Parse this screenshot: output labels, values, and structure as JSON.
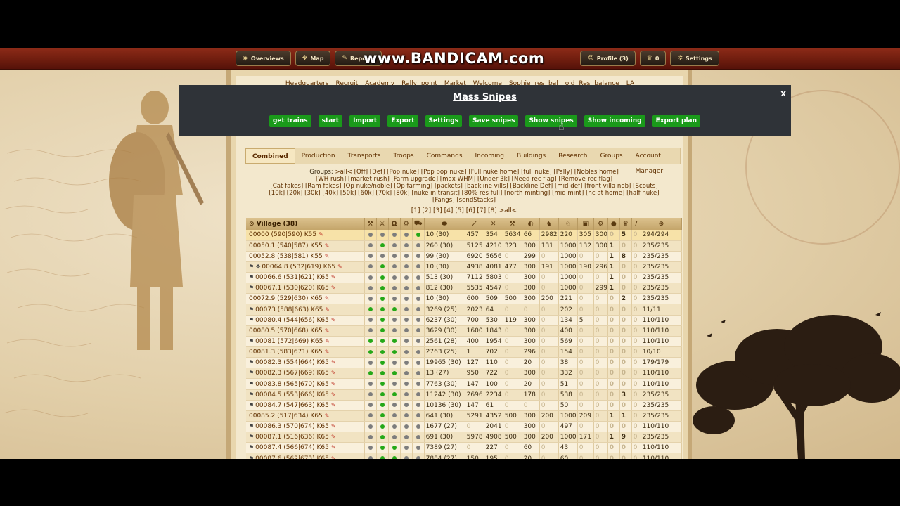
{
  "watermark": "www.BANDICAM.com",
  "topbar": {
    "buttons": [
      {
        "label": "Overviews",
        "icon": "globe-icon"
      },
      {
        "label": "Map",
        "icon": "map-icon"
      },
      {
        "label": "Reports",
        "icon": "report-icon"
      },
      {
        "label": "Profile (3)",
        "icon": "profile-icon"
      },
      {
        "label": "0",
        "icon": "premium-icon"
      },
      {
        "label": "Settings",
        "icon": "gear-icon"
      }
    ]
  },
  "village_links": [
    "Headquarters",
    "Recruit",
    "Academy",
    "Rally point",
    "Market",
    "Welcome",
    "Sophie res bal",
    "old Res balance",
    "LA"
  ],
  "modal": {
    "title": "Mass Snipes",
    "close": "x",
    "buttons": [
      "get trains",
      "start",
      "Import",
      "Export",
      "Settings",
      "Save snipes",
      "Show snipes",
      "Show incoming",
      "Export plan"
    ]
  },
  "tabs": [
    "Combined",
    "Production",
    "Transports",
    "Troops",
    "Commands",
    "Incoming",
    "Buildings",
    "Research",
    "Groups",
    "Account Manager"
  ],
  "groups": {
    "label": "Groups:",
    "lines": [
      ">all< [Off] [Def] [Pop nuke] [Pop pop nuke] [Full nuke home] [full nuke] [Pally] [Nobles home]",
      "[WH rush] [market rush] [Farm upgrade] [max WHM] [Under 3k] [Need rec flag] [Remove rec flag]",
      "[Cat fakes] [Ram fakes] [Op nuke/noble] [Op farming] [packets] [backline vills] [Backline Def] [mid def] [front villa nob] [Scouts]",
      "[10k] [20k] [30k] [40k] [50k] [60k] [70k] [80k] [nuke in transit] [80% res full] [north minting] [mid mint] [hc at home] [half nuke]",
      "[Fangs] [sendStacks]"
    ]
  },
  "pages": "[1] [2] [3] [4] [5] [6] [7] [8] >all<",
  "table": {
    "village_header": "Village (38)",
    "rows": [
      {
        "name": "00000 (590|590) K55",
        "flag": "",
        "dots": [
          "x",
          "x",
          "x",
          "x",
          "g"
        ],
        "farm": "10 (30)",
        "u": [
          "457",
          "354",
          "5634",
          "66",
          "2982",
          "220",
          "305",
          "300",
          "0",
          "5",
          "0"
        ],
        "pop": "294/294",
        "hl": true
      },
      {
        "name": "00050.1 (540|587) K55",
        "flag": "",
        "dots": [
          "x",
          "g",
          "x",
          "x",
          "x"
        ],
        "farm": "260 (30)",
        "u": [
          "5125",
          "4210",
          "323",
          "300",
          "131",
          "1000",
          "132",
          "300",
          "1",
          "0",
          "0"
        ],
        "pop": "235/235"
      },
      {
        "name": "00052.8 (538|581) K55",
        "flag": "",
        "dots": [
          "x",
          "x",
          "x",
          "x",
          "x"
        ],
        "farm": "99 (30)",
        "u": [
          "6920",
          "5656",
          "0",
          "299",
          "0",
          "1000",
          "0",
          "0",
          "1",
          "8",
          "0"
        ],
        "pop": "235/235"
      },
      {
        "name": "00064.8 (532|619) K65",
        "flag": "both",
        "dots": [
          "x",
          "g",
          "x",
          "x",
          "x"
        ],
        "farm": "10 (30)",
        "u": [
          "4938",
          "4081",
          "477",
          "300",
          "191",
          "1000",
          "190",
          "296",
          "1",
          "0",
          "0"
        ],
        "pop": "235/235"
      },
      {
        "name": "00066.6 (531|621) K65",
        "flag": "flag",
        "dots": [
          "x",
          "g",
          "x",
          "x",
          "x"
        ],
        "farm": "513 (30)",
        "u": [
          "7112",
          "5803",
          "0",
          "300",
          "0",
          "1000",
          "0",
          "0",
          "1",
          "0",
          "0"
        ],
        "pop": "235/235"
      },
      {
        "name": "00067.1 (530|620) K65",
        "flag": "flag",
        "dots": [
          "x",
          "g",
          "x",
          "x",
          "x"
        ],
        "farm": "812 (30)",
        "u": [
          "5535",
          "4547",
          "0",
          "300",
          "0",
          "1000",
          "0",
          "299",
          "1",
          "0",
          "0"
        ],
        "pop": "235/235"
      },
      {
        "name": "00072.9 (529|630) K65",
        "flag": "",
        "dots": [
          "x",
          "g",
          "x",
          "x",
          "x"
        ],
        "farm": "10 (30)",
        "u": [
          "600",
          "509",
          "500",
          "300",
          "200",
          "221",
          "0",
          "0",
          "0",
          "2",
          "0"
        ],
        "pop": "235/235"
      },
      {
        "name": "00073 (588|663) K65",
        "flag": "flag",
        "dots": [
          "g",
          "g",
          "g",
          "x",
          "x"
        ],
        "farm": "3269 (25)",
        "u": [
          "2023",
          "64",
          "0",
          "0",
          "0",
          "202",
          "0",
          "0",
          "0",
          "0",
          "0"
        ],
        "pop": "11/11"
      },
      {
        "name": "00080.4 (544|656) K65",
        "flag": "flag",
        "dots": [
          "x",
          "g",
          "x",
          "x",
          "x"
        ],
        "farm": "6237 (30)",
        "u": [
          "700",
          "530",
          "119",
          "300",
          "0",
          "134",
          "5",
          "0",
          "0",
          "0",
          "0"
        ],
        "pop": "110/110"
      },
      {
        "name": "00080.5 (570|668) K65",
        "flag": "",
        "dots": [
          "x",
          "g",
          "x",
          "x",
          "x"
        ],
        "farm": "3629 (30)",
        "u": [
          "1600",
          "1843",
          "0",
          "300",
          "0",
          "400",
          "0",
          "0",
          "0",
          "0",
          "0"
        ],
        "pop": "110/110"
      },
      {
        "name": "00081 (572|669) K65",
        "flag": "flag",
        "dots": [
          "g",
          "g",
          "g",
          "x",
          "x"
        ],
        "farm": "2561 (28)",
        "u": [
          "400",
          "1954",
          "0",
          "300",
          "0",
          "569",
          "0",
          "0",
          "0",
          "0",
          "0"
        ],
        "pop": "110/110"
      },
      {
        "name": "00081.3 (583|671) K65",
        "flag": "",
        "dots": [
          "g",
          "g",
          "g",
          "x",
          "x"
        ],
        "farm": "2763 (25)",
        "u": [
          "1",
          "702",
          "0",
          "296",
          "0",
          "154",
          "0",
          "0",
          "0",
          "0",
          "0"
        ],
        "pop": "10/10"
      },
      {
        "name": "00082.3 (554|664) K65",
        "flag": "flag",
        "dots": [
          "x",
          "g",
          "x",
          "x",
          "x"
        ],
        "farm": "19965 (30)",
        "u": [
          "127",
          "110",
          "0",
          "20",
          "0",
          "38",
          "0",
          "0",
          "0",
          "0",
          "0"
        ],
        "pop": "179/179"
      },
      {
        "name": "00082.3 (567|669) K65",
        "flag": "flag",
        "dots": [
          "g",
          "g",
          "g",
          "x",
          "x"
        ],
        "farm": "13 (27)",
        "u": [
          "950",
          "722",
          "0",
          "300",
          "0",
          "332",
          "0",
          "0",
          "0",
          "0",
          "0"
        ],
        "pop": "110/110"
      },
      {
        "name": "00083.8 (565|670) K65",
        "flag": "flag",
        "dots": [
          "x",
          "g",
          "x",
          "x",
          "x"
        ],
        "farm": "7763 (30)",
        "u": [
          "147",
          "100",
          "0",
          "20",
          "0",
          "51",
          "0",
          "0",
          "0",
          "0",
          "0"
        ],
        "pop": "110/110"
      },
      {
        "name": "00084.5 (553|666) K65",
        "flag": "flag",
        "dots": [
          "x",
          "g",
          "g",
          "x",
          "x"
        ],
        "farm": "11242 (30)",
        "u": [
          "2696",
          "2234",
          "0",
          "178",
          "0",
          "538",
          "0",
          "0",
          "0",
          "3",
          "0"
        ],
        "pop": "235/235"
      },
      {
        "name": "00084.7 (547|663) K65",
        "flag": "flag",
        "dots": [
          "x",
          "g",
          "x",
          "x",
          "x"
        ],
        "farm": "10136 (30)",
        "u": [
          "147",
          "61",
          "0",
          "0",
          "0",
          "50",
          "0",
          "0",
          "0",
          "0",
          "0"
        ],
        "pop": "235/235"
      },
      {
        "name": "00085.2 (517|634) K65",
        "flag": "",
        "dots": [
          "x",
          "g",
          "x",
          "x",
          "x"
        ],
        "farm": "641 (30)",
        "u": [
          "5291",
          "4352",
          "500",
          "300",
          "200",
          "1000",
          "209",
          "0",
          "1",
          "1",
          "0"
        ],
        "pop": "235/235"
      },
      {
        "name": "00086.3 (570|674) K65",
        "flag": "flag",
        "dots": [
          "x",
          "g",
          "x",
          "x",
          "x"
        ],
        "farm": "1677 (27)",
        "u": [
          "0",
          "2041",
          "0",
          "300",
          "0",
          "497",
          "0",
          "0",
          "0",
          "0",
          "0"
        ],
        "pop": "110/110"
      },
      {
        "name": "00087.1 (516|636) K65",
        "flag": "flag",
        "dots": [
          "x",
          "g",
          "x",
          "x",
          "x"
        ],
        "farm": "691 (30)",
        "u": [
          "5978",
          "4908",
          "500",
          "300",
          "200",
          "1000",
          "171",
          "0",
          "1",
          "9",
          "0"
        ],
        "pop": "235/235"
      },
      {
        "name": "00087.4 (566|674) K65",
        "flag": "flag",
        "dots": [
          "x",
          "g",
          "g",
          "x",
          "x"
        ],
        "farm": "7389 (27)",
        "u": [
          "0",
          "227",
          "0",
          "60",
          "0",
          "43",
          "0",
          "0",
          "0",
          "0",
          "0"
        ],
        "pop": "110/110"
      },
      {
        "name": "00087.6 (562|673) K65",
        "flag": "flag",
        "dots": [
          "x",
          "g",
          "g",
          "x",
          "x"
        ],
        "farm": "7884 (27)",
        "u": [
          "150",
          "195",
          "0",
          "20",
          "0",
          "60",
          "0",
          "0",
          "0",
          "0",
          "0"
        ],
        "pop": "110/110"
      }
    ]
  }
}
